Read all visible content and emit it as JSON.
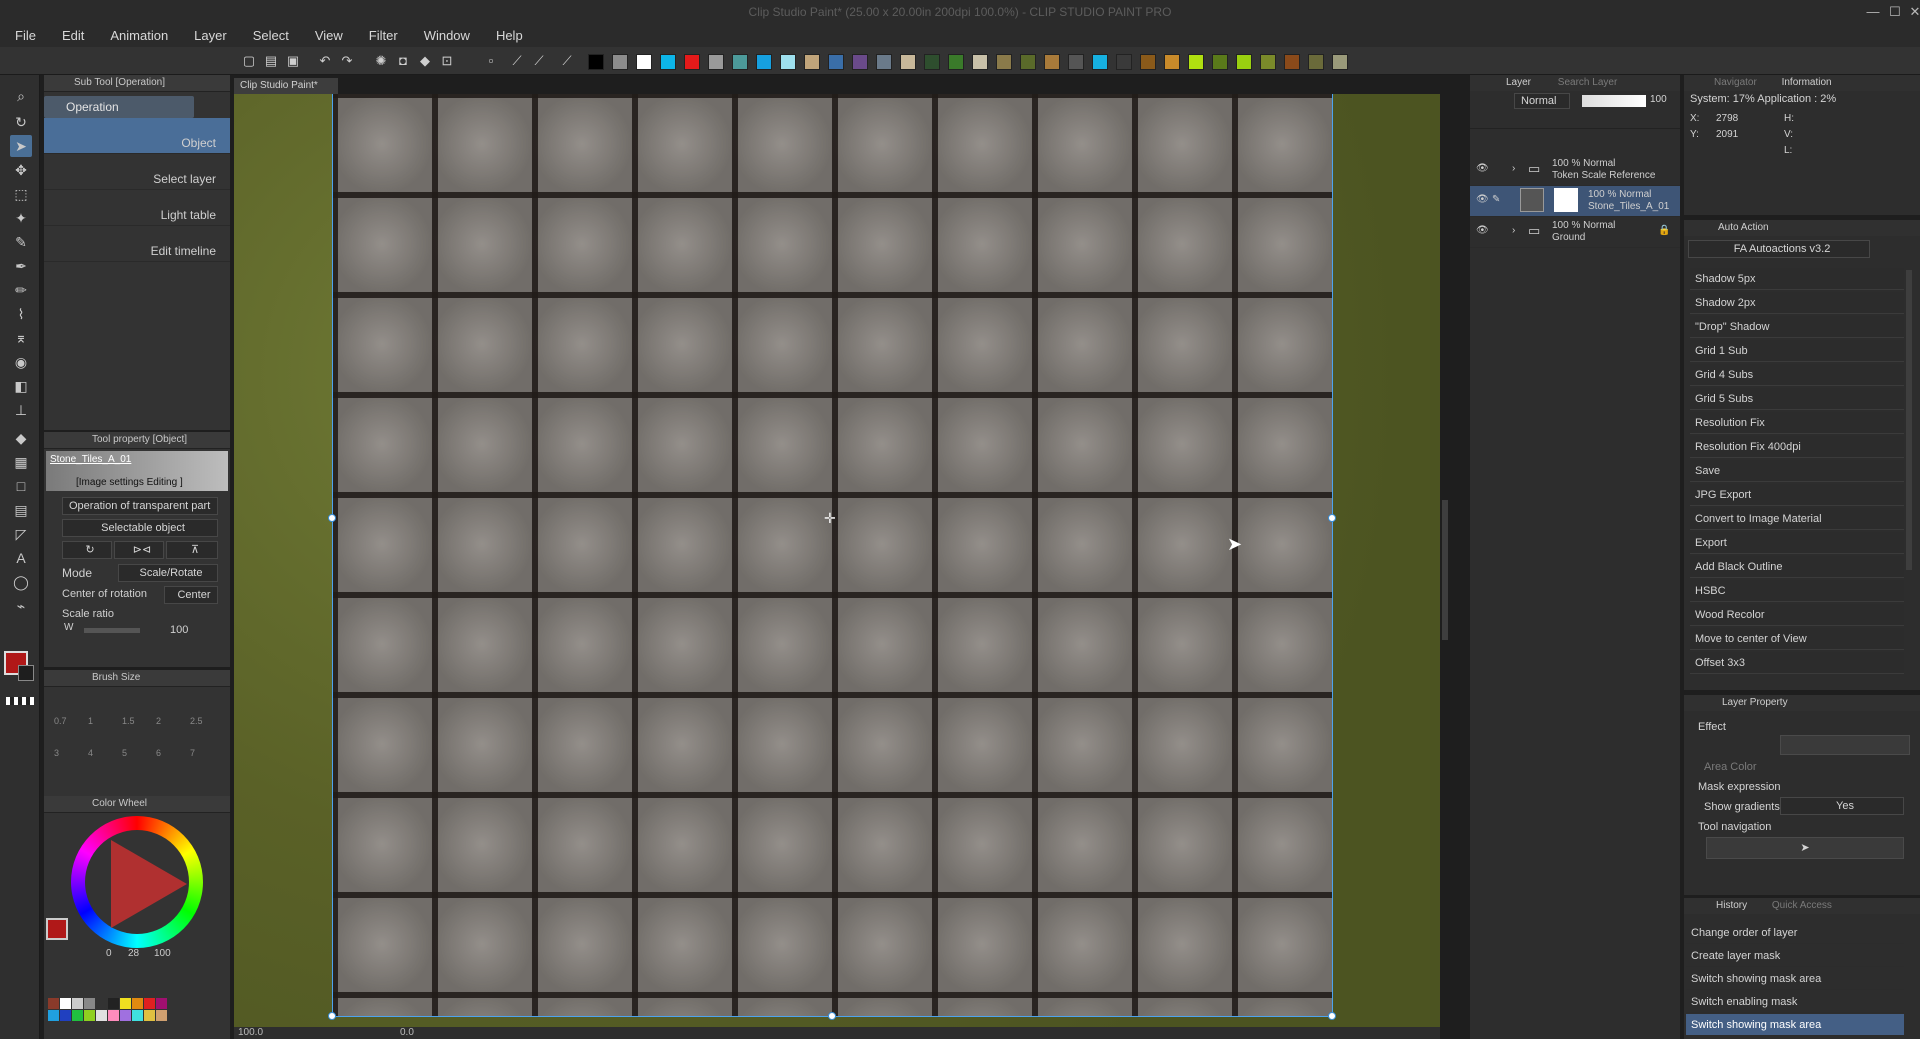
{
  "app_title": "Clip Studio Paint* (25.00 x 20.00in 200dpi 100.0%) - CLIP STUDIO PAINT PRO",
  "window_controls": {
    "minimize": "—",
    "maximize": "☐",
    "close": "✕"
  },
  "menu": [
    "File",
    "Edit",
    "Animation",
    "Layer",
    "Select",
    "View",
    "Filter",
    "Window",
    "Help"
  ],
  "command_bar": {
    "palette": [
      "#000000",
      "#8c8c8c",
      "#ffffff",
      "#0db5e8",
      "#e41a1a",
      "#9a9a9a",
      "#4c9a9a",
      "#16a0e0",
      "#9ee0ee",
      "#c0a47a",
      "#3a6ea8",
      "#6a4a8a",
      "#6a7a8a",
      "#c8b89a",
      "#2e4e2e",
      "#3a7a2a",
      "#c8c0a8",
      "#8a7a4a",
      "#5a6a2a",
      "#a87a3a",
      "#555555",
      "#16b0e0",
      "#3a3a3a",
      "#8a5a1a",
      "#c88a2a",
      "#b0e010",
      "#5a7a1a",
      "#9ad010",
      "#7a8a2a",
      "#8a4a1a",
      "#6a6a3a",
      "#9a9a7a"
    ]
  },
  "subtool_panel": {
    "header": "Sub Tool [Operation]",
    "group": "Operation",
    "items": [
      "Object",
      "Select layer",
      "Light table",
      "Edit timeline"
    ]
  },
  "tool_property": {
    "header": "Tool property [Object]",
    "layer_name": "Stone_Tiles_A_01",
    "image_settings": "[Image settings Editing ]",
    "transparent_op": "Operation of transparent part",
    "selectable": "Selectable object",
    "mode_label": "Mode",
    "mode_value": "Scale/Rotate",
    "rotation_label": "Center of rotation",
    "rotation_value": "Center",
    "scale_label": "Scale ratio",
    "w_label": "W",
    "w_value": "100"
  },
  "brush_size": {
    "header": "Brush Size",
    "sizes": [
      "0.7",
      "1",
      "1.5",
      "2",
      "2.5",
      "3",
      "4",
      "5",
      "6",
      "7"
    ]
  },
  "color_wheel": {
    "header": "Color Wheel",
    "main_color": "#b01818",
    "readout": [
      "0",
      "28",
      "100"
    ]
  },
  "doc_tab": "Clip Studio Paint*",
  "status_bar": {
    "zoom": "100.0",
    "angle": "0.0"
  },
  "layer_panel": {
    "tabs": [
      "Layer",
      "Search Layer"
    ],
    "blend_mode": "Normal",
    "opacity": "100",
    "layers": [
      {
        "pct": "100 % Normal",
        "name": "Token Scale Reference",
        "type": "folder"
      },
      {
        "pct": "100 % Normal",
        "name": "Stone_Tiles_A_01",
        "type": "image",
        "selected": true
      },
      {
        "pct": "100 % Normal",
        "name": "Ground",
        "type": "folder",
        "locked": true
      }
    ]
  },
  "navigator": {
    "tabs": [
      "Navigator",
      "Information"
    ],
    "system_text": "System: 17%  Application : 2%",
    "x_label": "X:",
    "x_value": "2798",
    "y_label": "Y:",
    "y_value": "2091",
    "h_label": "H:",
    "v_label": "V:",
    "l_label": "L:"
  },
  "auto_action": {
    "header": "Auto Action",
    "set_name": "FA Autoactions v3.2",
    "items": [
      "Shadow 5px",
      "Shadow 2px",
      "\"Drop\" Shadow",
      "Grid 1 Sub",
      "Grid 4 Subs",
      "Grid 5 Subs",
      "Resolution Fix",
      "Resolution Fix 400dpi",
      "Save",
      "JPG Export",
      "Convert to Image Material",
      "Export",
      "Add Black Outline",
      "HSBC",
      "Wood Recolor",
      "Move to center of View",
      "Offset 3x3"
    ]
  },
  "layer_property": {
    "header": "Layer Property",
    "effect_label": "Effect",
    "area_color_label": "Area Color",
    "mask_expression_label": "Mask expression",
    "show_gradients_label": "Show gradients",
    "show_gradients_value": "Yes",
    "tool_nav_label": "Tool navigation"
  },
  "history": {
    "tabs": [
      "History",
      "Quick Access"
    ],
    "items": [
      "Change order of layer",
      "Create layer mask",
      "Switch showing mask area",
      "Switch enabling mask",
      "Switch showing mask area"
    ]
  }
}
